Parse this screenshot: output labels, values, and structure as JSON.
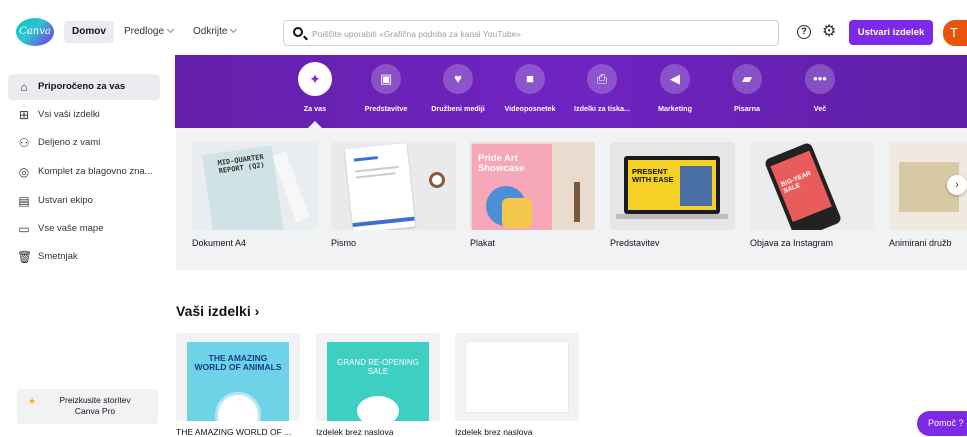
{
  "topbar": {
    "logo_text": "Canva",
    "nav": [
      {
        "label": "Domov"
      },
      {
        "label": "Predloge"
      },
      {
        "label": "Odkrijte"
      }
    ],
    "search_placeholder": "Poiščite uporabiti «Grafična podoba za kanal YouTube»",
    "help_icon": "question-icon",
    "help_glyph": "?",
    "settings_icon": "gear-icon",
    "create_label": "Ustvari izdelek",
    "avatar_initial": "T",
    "accent": "#7d2ae8"
  },
  "sidebar": {
    "items": [
      {
        "label": "Priporočeno za vas",
        "icon": "home-icon",
        "active": true
      },
      {
        "label": "Vsi vaši izdelki",
        "icon": "grid-icon"
      },
      {
        "label": "Deljeno z vami",
        "icon": "people-icon"
      },
      {
        "label": "Komplet za blagovno zna...",
        "icon": "brand-kit-icon"
      },
      {
        "label": "Ustvari ekipo",
        "icon": "team-icon"
      },
      {
        "label": "Vse vaše mape",
        "icon": "folder-icon"
      },
      {
        "label": "Smetnjak",
        "icon": "trash-icon"
      }
    ],
    "pro": {
      "line1": "Preizkusite storitev",
      "line2": "Canva Pro"
    }
  },
  "categories": [
    {
      "label": "Za vas",
      "icon": "sparkle-icon",
      "active": true
    },
    {
      "label": "Predstavitve",
      "icon": "presentation-icon"
    },
    {
      "label": "Družbeni mediji",
      "icon": "social-heart-icon"
    },
    {
      "label": "Videoposnetek",
      "icon": "video-camera-icon"
    },
    {
      "label": "Izdelki za tiska...",
      "icon": "print-icon"
    },
    {
      "label": "Marketing",
      "icon": "megaphone-icon"
    },
    {
      "label": "Pisarna",
      "icon": "briefcase-icon"
    },
    {
      "label": "Več",
      "icon": "more-icon"
    }
  ],
  "templates": [
    {
      "label": "Dokument A4",
      "thumb_text": "MID-QUARTER REPORT (Q2)"
    },
    {
      "label": "Pismo",
      "thumb_text": ""
    },
    {
      "label": "Plakat",
      "thumb_text": "Pride Art Showcase"
    },
    {
      "label": "Predstavitev",
      "thumb_text": "PRESENT WITH EASE"
    },
    {
      "label": "Objava za Instagram",
      "thumb_text": "BIG-YEAR SALE"
    },
    {
      "label": "Animirani družb",
      "thumb_text": ""
    }
  ],
  "yours": {
    "title": "Vaši izdelki",
    "chevron": "›",
    "items": [
      {
        "label": "THE AMAZING WORLD OF ...",
        "thumb_text": "THE AMAZING WORLD OF ANIMALS"
      },
      {
        "label": "Izdelek brez naslova",
        "thumb_text": "GRAND RE-OPENING SALE"
      },
      {
        "label": "Izdelek brez naslova",
        "thumb_text": ""
      }
    ]
  },
  "help_pill": "Pomoč ?"
}
